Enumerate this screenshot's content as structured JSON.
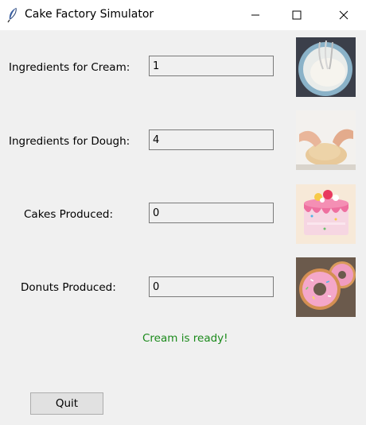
{
  "window": {
    "title": "Cake Factory Simulator",
    "icon": "feather-icon"
  },
  "fields": {
    "cream": {
      "label": "Ingredients for Cream:",
      "value": "1",
      "image": "cream-bowl-photo"
    },
    "dough": {
      "label": "Ingredients for Dough:",
      "value": "4",
      "image": "kneading-dough-photo"
    },
    "cakes": {
      "label": "Cakes Produced:",
      "value": "0",
      "image": "pink-cake-photo"
    },
    "donuts": {
      "label": "Donuts Produced:",
      "value": "0",
      "image": "pink-donuts-photo"
    }
  },
  "status": {
    "text": "Cream is ready!",
    "color": "#1b8a1b"
  },
  "quit_label": "Quit"
}
